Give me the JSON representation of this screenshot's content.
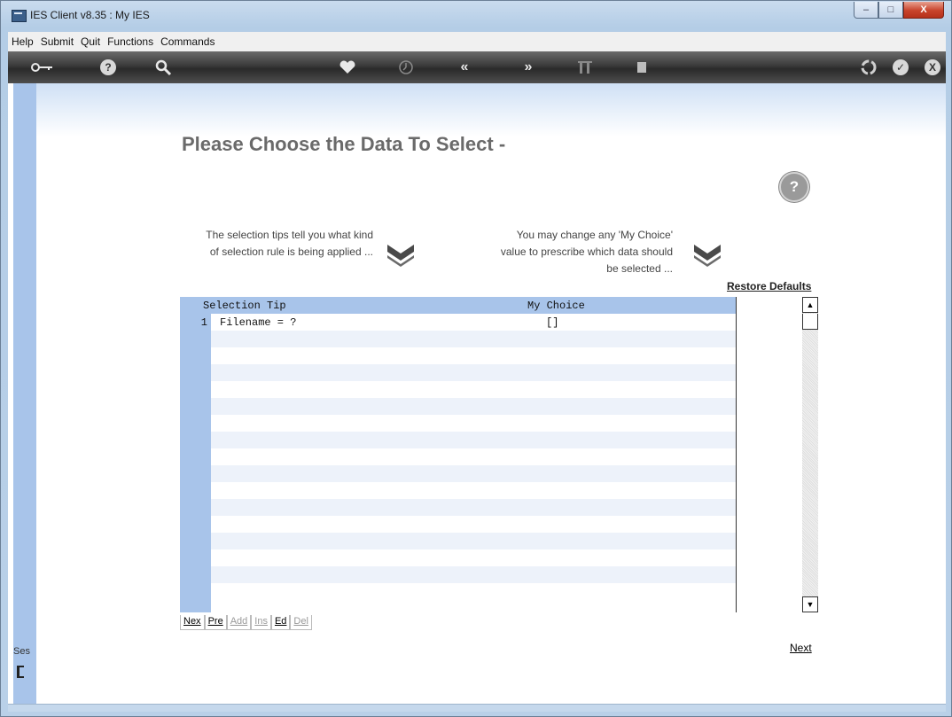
{
  "window": {
    "title": "IES Client v8.35 : My IES",
    "controls": {
      "minimize": "–",
      "maximize": "□",
      "close": "X"
    }
  },
  "menu": {
    "items": [
      "Help",
      "Submit",
      "Quit",
      "Functions",
      "Commands"
    ]
  },
  "toolbar": {
    "icons": [
      "key-icon",
      "help-icon",
      "search-icon",
      "heart-icon",
      "clock-icon",
      "rewind-icon",
      "forward-icon",
      "tools-icon",
      "stop-icon",
      "recycle-icon",
      "check-icon",
      "close-icon"
    ],
    "help_glyph": "?",
    "check_glyph": "✓",
    "close_glyph": "X"
  },
  "page": {
    "title": "Please Choose the Data To Select -",
    "help_glyph": "?",
    "tip_left": [
      "The selection tips tell you what kind",
      "of selection rule is being applied ..."
    ],
    "tip_right": [
      "You may change any 'My Choice'",
      "value to prescribe which data should",
      "be selected ..."
    ],
    "restore_defaults": "Restore Defaults",
    "next": "Next"
  },
  "grid": {
    "columns": [
      "Selection Tip",
      "My Choice"
    ],
    "rows": [
      {
        "num": "1",
        "tip": "Filename = ?",
        "choice": "[]"
      }
    ],
    "empty_rows": 16
  },
  "row_buttons": [
    {
      "label": "Nex",
      "enabled": true
    },
    {
      "label": "Pre",
      "enabled": true
    },
    {
      "label": "Add",
      "enabled": false
    },
    {
      "label": "Ins",
      "enabled": false
    },
    {
      "label": "Ed",
      "enabled": true
    },
    {
      "label": "Del",
      "enabled": false
    }
  ],
  "scrollbar": {
    "up": "▲",
    "down": "▼"
  },
  "sidebar": {
    "session_label": "Ses"
  }
}
